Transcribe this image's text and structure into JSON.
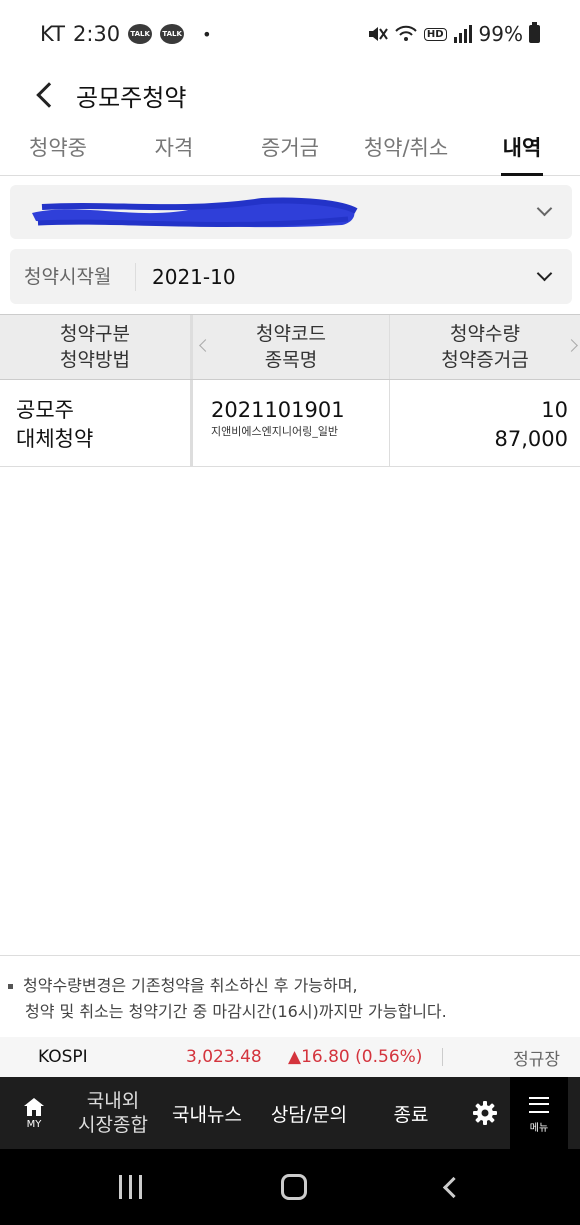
{
  "status_bar": {
    "carrier": "KT",
    "time": "2:30",
    "talk_badge": "TALK",
    "dot": "•",
    "hd_badge": "HD",
    "battery": "99%"
  },
  "header": {
    "title": "공모주청약"
  },
  "tabs": [
    {
      "label": "청약중",
      "active": false
    },
    {
      "label": "자격",
      "active": false
    },
    {
      "label": "증거금",
      "active": false
    },
    {
      "label": "청약/취소",
      "active": false
    },
    {
      "label": "내역",
      "active": true
    }
  ],
  "filters": {
    "month_label": "청약시작월",
    "month_value": "2021-10"
  },
  "table": {
    "headers": [
      {
        "line1": "청약구분",
        "line2": "청약방법"
      },
      {
        "line1": "청약코드",
        "line2": "종목명"
      },
      {
        "line1": "청약수량",
        "line2": "청약증거금"
      }
    ],
    "rows": [
      {
        "type": "공모주",
        "method": "대체청약",
        "code": "2021101901",
        "name": "지앤비에스엔지니어링_일반",
        "quantity": "10",
        "deposit": "87,000"
      }
    ]
  },
  "notice": {
    "line1": "청약수량변경은 기존청약을 취소하신 후 가능하며,",
    "line2": "청약 및 취소는 청약기간 중 마감시간(16시)까지만 가능합니다."
  },
  "ticker": {
    "name": "KOSPI",
    "value": "3,023.48",
    "change": "▲16.80 (0.56%)",
    "status": "정규장",
    "up_color": "#d4343d"
  },
  "bottom_nav": {
    "my_label": "MY",
    "market_label_1": "국내외",
    "market_label_2": "시장종합",
    "news_label": "국내뉴스",
    "consult_label": "상담/문의",
    "exit_label": "종료",
    "menu_label": "메뉴"
  }
}
